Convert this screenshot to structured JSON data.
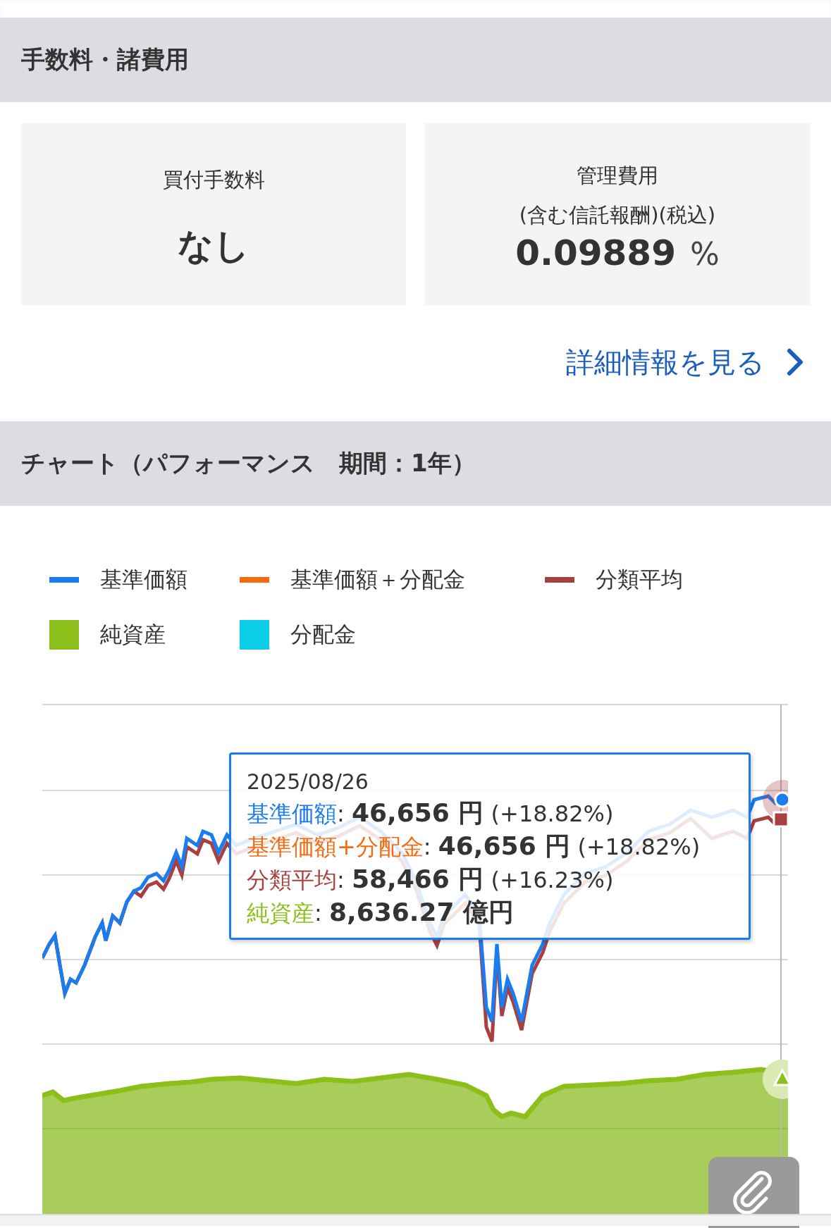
{
  "fees_section": {
    "title": "手数料・諸費用"
  },
  "fee_cards": [
    {
      "title_lines": [
        "買付手数料"
      ],
      "value": "なし"
    },
    {
      "title_lines": [
        "管理費用",
        "(含む信託報酬)(税込)"
      ],
      "value": "0.09889",
      "unit": "%"
    }
  ],
  "detail_link": {
    "label": "詳細情報を見る"
  },
  "chart_section": {
    "title": "チャート（パフォーマンス　期間：1年）"
  },
  "legend": [
    {
      "label": "基準価額",
      "kind": "line",
      "color": "#1a7cf0"
    },
    {
      "label": "基準価額＋分配金",
      "kind": "line",
      "color": "#f56a0f"
    },
    {
      "label": "分類平均",
      "kind": "line",
      "color": "#a84040"
    },
    {
      "label": "純資産",
      "kind": "area",
      "color": "#8cbf1a"
    },
    {
      "label": "分配金",
      "kind": "area",
      "color": "#0ccde6"
    }
  ],
  "tooltip": {
    "date": "2025/08/26",
    "rows": [
      {
        "label": "基準価額",
        "color": "#1a7cf0",
        "separator": ":",
        "value": "46,656 円",
        "change": "(+18.82%)"
      },
      {
        "label": "基準価額+分配金",
        "color": "#f56a0f",
        "separator": ":",
        "value": "46,656 円",
        "change": "(+18.82%)"
      },
      {
        "label": "分類平均",
        "color": "#a84040",
        "separator": ":",
        "value": "58,466 円",
        "change": "(+16.23%)"
      },
      {
        "label": "純資産",
        "color": "#8cbf1a",
        "separator": ":",
        "value": "8,636.27 億円"
      }
    ]
  }
}
